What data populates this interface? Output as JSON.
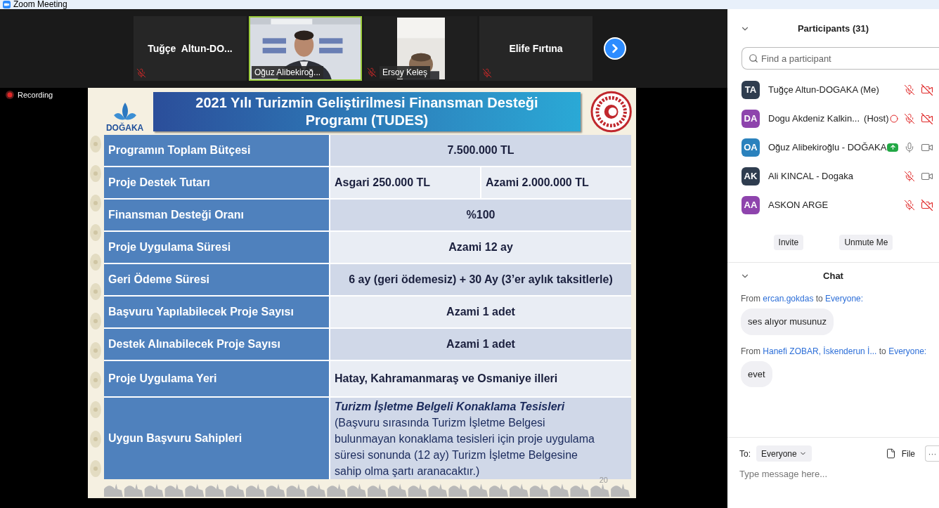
{
  "window": {
    "title": "Zoom Meeting"
  },
  "gallery": {
    "tiles": [
      {
        "kind": "name",
        "name": "Tuğçe  Altun-DO...",
        "muted": true,
        "speaking": false
      },
      {
        "kind": "video",
        "portrait": false,
        "name": "Oğuz Alibekiroğ...",
        "muted": false,
        "speaking": true
      },
      {
        "kind": "video",
        "portrait": true,
        "name": "Ersoy Keleş",
        "muted": true,
        "speaking": false
      },
      {
        "kind": "name",
        "name": "Elife Fırtına",
        "muted": true,
        "speaking": false
      }
    ]
  },
  "recording": {
    "label": "Recording"
  },
  "slide": {
    "logo_text": "DOĞAKA",
    "title": "2021 Yılı Turizmin Geliştirilmesi Finansman Desteği Programı (TUDES)",
    "rows": [
      {
        "kind": "plain",
        "label": "Programın Toplam Bütçesi",
        "values": [
          "7.500.000 TL"
        ]
      },
      {
        "kind": "plain",
        "label": "Proje Destek Tutarı",
        "values": [
          "Asgari 250.000 TL",
          "Azami 2.000.000 TL"
        ]
      },
      {
        "kind": "plain",
        "label": "Finansman Desteği Oranı",
        "values": [
          "%100"
        ]
      },
      {
        "kind": "plain",
        "label": "Proje Uygulama Süresi",
        "values": [
          "Azami 12 ay"
        ]
      },
      {
        "kind": "plain",
        "label": "Geri Ödeme Süresi",
        "values": [
          "6 ay (geri ödemesiz) + 30 Ay (3’er aylık taksitlerle)"
        ]
      },
      {
        "kind": "plain",
        "label": "Başvuru Yapılabilecek Proje Sayısı",
        "values": [
          "Azami 1 adet"
        ]
      },
      {
        "kind": "plain",
        "label": "Destek Alınabilecek Proje Sayısı",
        "values": [
          "Azami 1 adet"
        ]
      },
      {
        "kind": "left",
        "label": "Proje Uygulama Yeri",
        "values": [
          "Hatay, Kahramanmaraş ve Osmaniye illeri"
        ]
      },
      {
        "kind": "note",
        "label": "Uygun Başvuru Sahipleri",
        "heading": "Turizm İşletme Belgeli Konaklama Tesisleri",
        "body": "(Başvuru sırasında Turizm İşletme Belgesi\nbulunmayan konaklama tesisleri için proje uygulama\nsüresi sonunda (12 ay) Turizm İşletme Belgesine\nsahip olma şartı aranacaktır.)"
      }
    ],
    "page_number": "20"
  },
  "participants": {
    "title": "Participants (31)",
    "search_placeholder": "Find a participant",
    "items": [
      {
        "initials": "TA",
        "color": "#2f3d4f",
        "name": "Tuğçe Altun-DOGAKA (Me)",
        "recording": false,
        "sharing": false,
        "muted": true,
        "camera_off": true
      },
      {
        "initials": "DA",
        "color": "#8e44ad",
        "name": "Dogu Akdeniz Kalkin...",
        "role": "(Host)",
        "recording": true,
        "sharing": false,
        "muted": true,
        "camera_off": true
      },
      {
        "initials": "OA",
        "color": "#2b82bd",
        "name": "Oğuz Alibekiroğlu - DOĞAKA",
        "recording": false,
        "sharing": true,
        "muted": false,
        "camera_off": false
      },
      {
        "initials": "AK",
        "color": "#2f3d4f",
        "name": "Ali KINCAL - Dogaka",
        "recording": false,
        "sharing": false,
        "muted": true,
        "camera_off": false
      },
      {
        "initials": "AA",
        "color": "#8e44ad",
        "name": "ASKON ARGE",
        "recording": false,
        "sharing": false,
        "muted": true,
        "camera_off": true
      }
    ],
    "buttons": [
      "Invite",
      "Unmute Me"
    ]
  },
  "chat": {
    "title": "Chat",
    "messages": [
      {
        "prefix": "From",
        "sender": "ercan.gokdas",
        "joiner": "to",
        "recipient": "Everyone:",
        "text": "ses alıyor musunuz"
      },
      {
        "prefix": "From",
        "sender": "Hanefi ZOBAR, İskenderun İ...",
        "joiner": "to",
        "recipient": "Everyone:",
        "text": "evet"
      }
    ],
    "to_label": "To:",
    "to_value": "Everyone",
    "file_label": "File",
    "more_label": "···",
    "input_placeholder": "Type message here..."
  }
}
